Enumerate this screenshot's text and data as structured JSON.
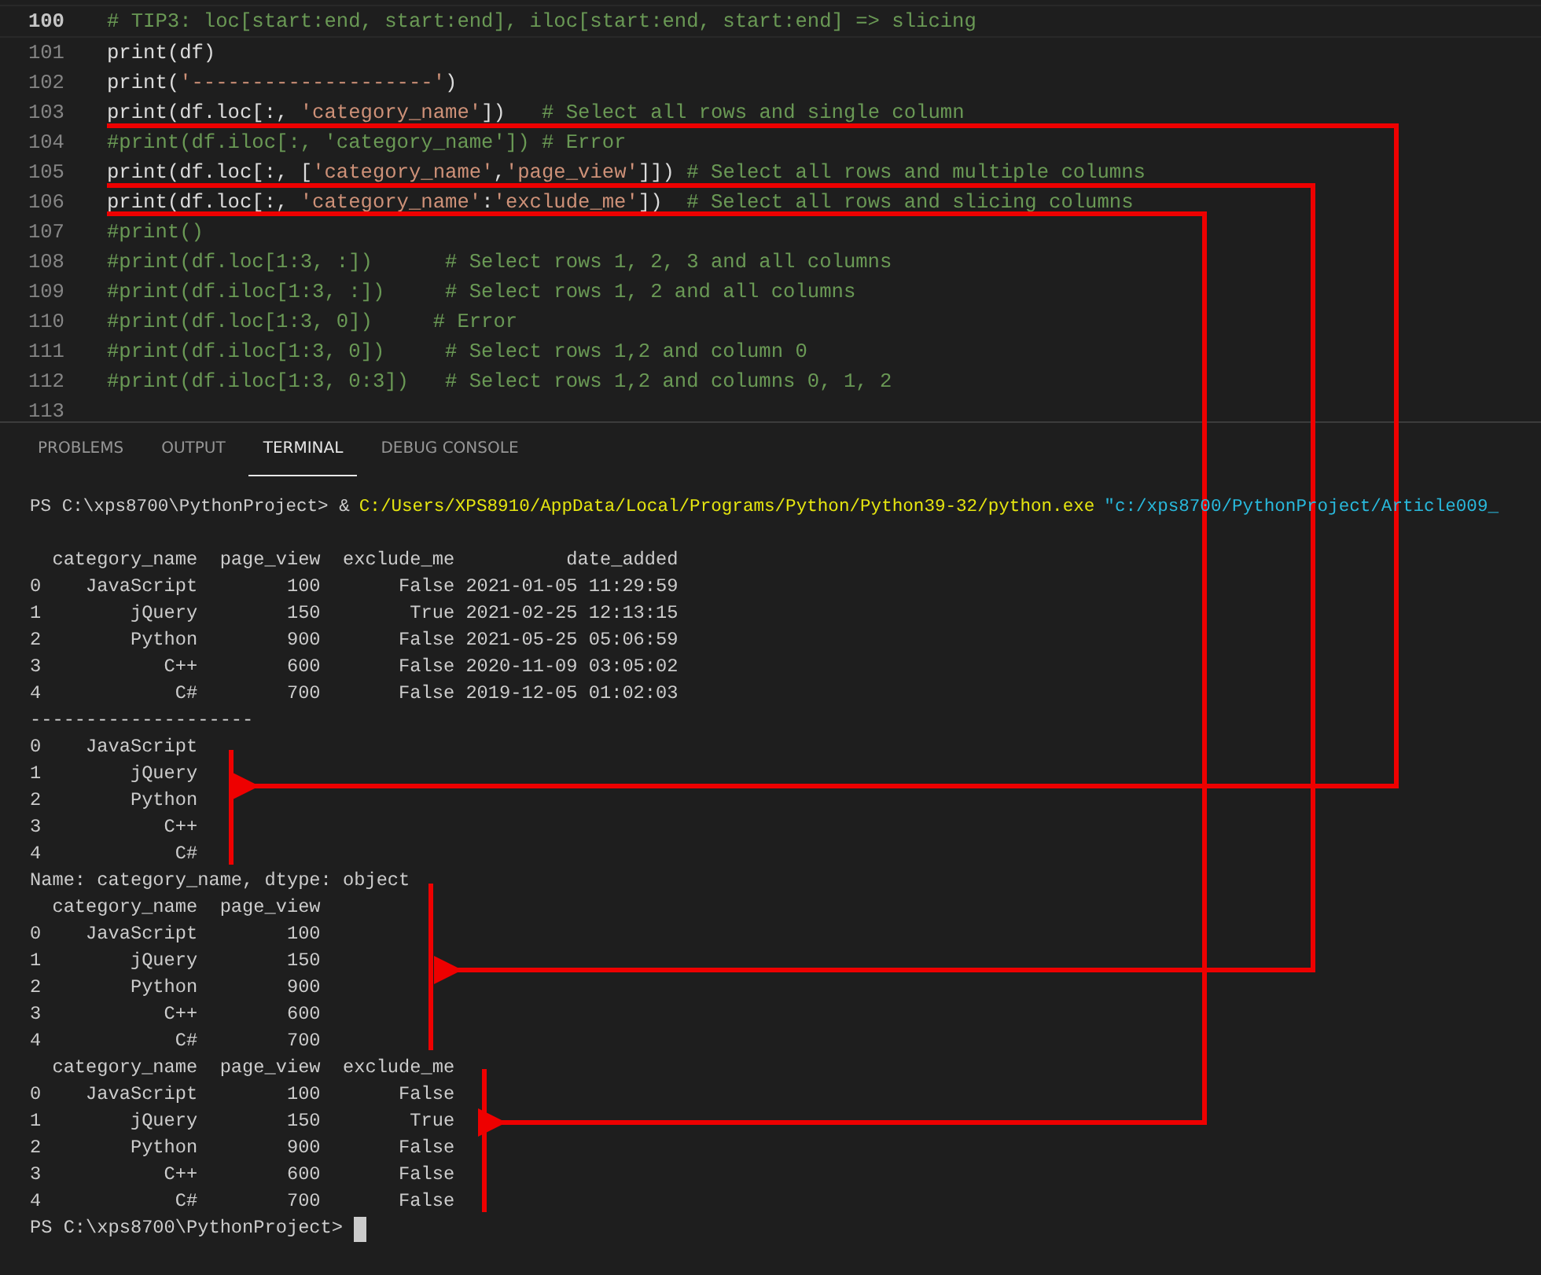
{
  "editor": {
    "lines": [
      {
        "number": "100",
        "current": true,
        "segments": [
          {
            "kind": "comment",
            "text": "# TIP3: loc[start:end, start:end], iloc[start:end, start:end] => slicing"
          }
        ]
      },
      {
        "number": "101",
        "current": false,
        "segments": [
          {
            "kind": "code",
            "text": "print(df)"
          }
        ]
      },
      {
        "number": "102",
        "current": false,
        "segments": [
          {
            "kind": "code",
            "text": "print("
          },
          {
            "kind": "string",
            "text": "'--------------------'"
          },
          {
            "kind": "code",
            "text": ")"
          }
        ]
      },
      {
        "number": "103",
        "current": false,
        "segments": [
          {
            "kind": "code",
            "text": "print(df.loc[:, "
          },
          {
            "kind": "string",
            "text": "'category_name'"
          },
          {
            "kind": "code",
            "text": "])   "
          },
          {
            "kind": "comment",
            "text": "# Select all rows and single column"
          }
        ]
      },
      {
        "number": "104",
        "current": false,
        "segments": [
          {
            "kind": "comment",
            "text": "#print(df.iloc[:, 'category_name']) # Error"
          }
        ]
      },
      {
        "number": "105",
        "current": false,
        "segments": [
          {
            "kind": "code",
            "text": "print(df.loc[:, ["
          },
          {
            "kind": "string",
            "text": "'category_name'"
          },
          {
            "kind": "code",
            "text": ","
          },
          {
            "kind": "string",
            "text": "'page_view'"
          },
          {
            "kind": "code",
            "text": "]]) "
          },
          {
            "kind": "comment",
            "text": "# Select all rows and multiple columns"
          }
        ]
      },
      {
        "number": "106",
        "current": false,
        "segments": [
          {
            "kind": "code",
            "text": "print(df.loc[:, "
          },
          {
            "kind": "string",
            "text": "'category_name'"
          },
          {
            "kind": "code",
            "text": ":"
          },
          {
            "kind": "string",
            "text": "'exclude_me'"
          },
          {
            "kind": "code",
            "text": "])  "
          },
          {
            "kind": "comment",
            "text": "# Select all rows and slicing columns"
          }
        ]
      },
      {
        "number": "107",
        "current": false,
        "segments": [
          {
            "kind": "comment",
            "text": "#print()"
          }
        ]
      },
      {
        "number": "108",
        "current": false,
        "segments": [
          {
            "kind": "comment",
            "text": "#print(df.loc[1:3, :])      # Select rows 1, 2, 3 and all columns"
          }
        ]
      },
      {
        "number": "109",
        "current": false,
        "segments": [
          {
            "kind": "comment",
            "text": "#print(df.iloc[1:3, :])     # Select rows 1, 2 and all columns"
          }
        ]
      },
      {
        "number": "110",
        "current": false,
        "segments": [
          {
            "kind": "comment",
            "text": "#print(df.loc[1:3, 0])     # Error"
          }
        ]
      },
      {
        "number": "111",
        "current": false,
        "segments": [
          {
            "kind": "comment",
            "text": "#print(df.iloc[1:3, 0])     # Select rows 1,2 and column 0"
          }
        ]
      },
      {
        "number": "112",
        "current": false,
        "segments": [
          {
            "kind": "comment",
            "text": "#print(df.iloc[1:3, 0:3])   # Select rows 1,2 and columns 0, 1, 2"
          }
        ]
      },
      {
        "number": "113",
        "current": false
      }
    ]
  },
  "panel_tabs": [
    {
      "label": "PROBLEMS",
      "selected": false
    },
    {
      "label": "OUTPUT",
      "selected": false
    },
    {
      "label": "TERMINAL",
      "selected": true
    },
    {
      "label": "DEBUG CONSOLE",
      "selected": false
    }
  ],
  "terminal": {
    "command": {
      "prompt": "PS C:\\xps8700\\PythonProject> &",
      "executable": "C:/Users/XPS8910/AppData/Local/Programs/Python/Python39-32/python.exe",
      "argument": "\"c:/xps8700/PythonProject/Article009_"
    },
    "output": [
      "  category_name  page_view  exclude_me          date_added",
      "0    JavaScript        100       False 2021-01-05 11:29:59",
      "1        jQuery        150        True 2021-02-25 12:13:15",
      "2        Python        900       False 2021-05-25 05:06:59",
      "3           C++        600       False 2020-11-09 03:05:02",
      "4            C#        700       False 2019-12-05 01:02:03",
      "--------------------",
      "0    JavaScript",
      "1        jQuery",
      "2        Python",
      "3           C++",
      "4            C#",
      "Name: category_name, dtype: object",
      "  category_name  page_view",
      "0    JavaScript        100",
      "1        jQuery        150",
      "2        Python        900",
      "3           C++        600",
      "4            C#        700",
      "  category_name  page_view  exclude_me",
      "0    JavaScript        100       False",
      "1        jQuery        150        True",
      "2        Python        900       False",
      "3           C++        600       False",
      "4            C#        700       False"
    ],
    "prompt": "PS C:\\xps8700\\PythonProject>"
  }
}
